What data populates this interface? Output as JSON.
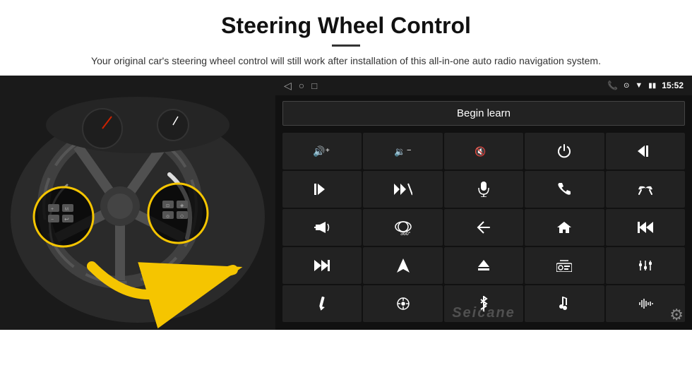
{
  "header": {
    "title": "Steering Wheel Control",
    "subtitle": "Your original car's steering wheel control will still work after installation of this all-in-one auto radio navigation system."
  },
  "display": {
    "status_bar": {
      "time": "15:52",
      "icons_left": [
        "back-arrow",
        "home-circle",
        "square-recent"
      ]
    },
    "begin_learn_label": "Begin learn",
    "controls": [
      {
        "icon": "vol-up",
        "unicode": "🔊+"
      },
      {
        "icon": "vol-down",
        "unicode": "🔉-"
      },
      {
        "icon": "mute",
        "unicode": "🔇"
      },
      {
        "icon": "power",
        "unicode": "⏻"
      },
      {
        "icon": "prev-track",
        "unicode": "⏮"
      },
      {
        "icon": "next-track",
        "unicode": "⏭"
      },
      {
        "icon": "fast-fwd-skip",
        "unicode": "⏭✕"
      },
      {
        "icon": "mic",
        "unicode": "🎤"
      },
      {
        "icon": "phone",
        "unicode": "📞"
      },
      {
        "icon": "hang-up",
        "unicode": "📵"
      },
      {
        "icon": "horn",
        "unicode": "📢"
      },
      {
        "icon": "360-cam",
        "unicode": "360°"
      },
      {
        "icon": "back",
        "unicode": "↩"
      },
      {
        "icon": "home",
        "unicode": "⌂"
      },
      {
        "icon": "skip-back",
        "unicode": "⏮"
      },
      {
        "icon": "fast-fwd",
        "unicode": "⏭"
      },
      {
        "icon": "nav",
        "unicode": "▶"
      },
      {
        "icon": "eject",
        "unicode": "⏏"
      },
      {
        "icon": "radio",
        "unicode": "📻"
      },
      {
        "icon": "equalizer",
        "unicode": "🎚"
      },
      {
        "icon": "pen",
        "unicode": "✏"
      },
      {
        "icon": "menu-circle",
        "unicode": "⊙"
      },
      {
        "icon": "bluetooth",
        "unicode": "✱"
      },
      {
        "icon": "music",
        "unicode": "🎵"
      },
      {
        "icon": "bars",
        "unicode": "▐▌"
      }
    ],
    "watermark": "Seicane",
    "gear_icon": "⚙"
  }
}
